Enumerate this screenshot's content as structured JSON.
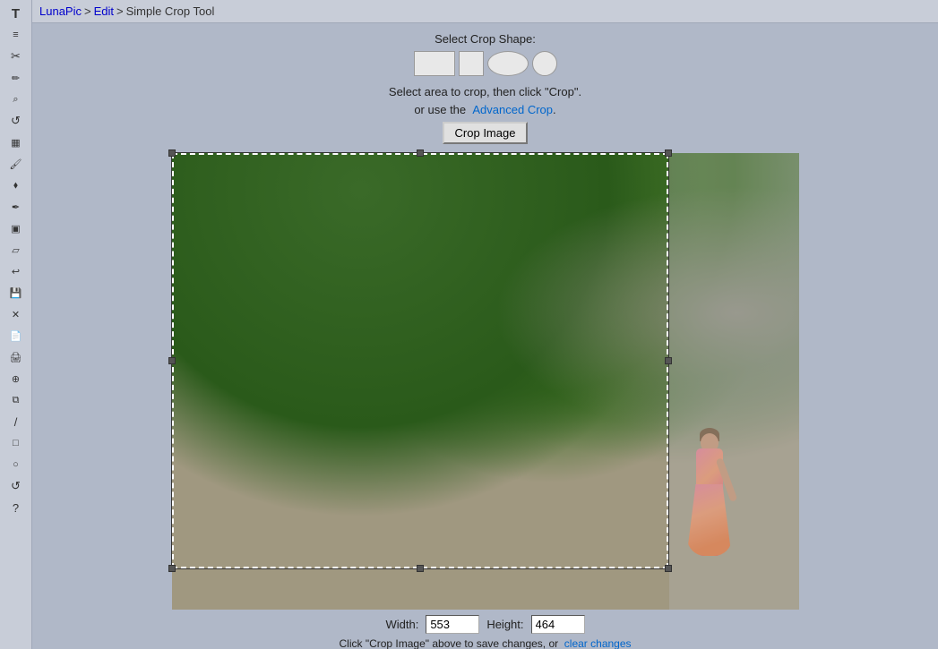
{
  "app": {
    "title": "LunaPic",
    "breadcrumb_sep": ">",
    "edit_label": "Edit",
    "page_label": "Simple Crop Tool"
  },
  "crop_shape": {
    "label": "Select Crop Shape:"
  },
  "instructions": {
    "line1": "Select area to crop, then click \"Crop\".",
    "line2_prefix": "or use the",
    "advanced_link": "Advanced Crop",
    "advanced_link_suffix": "."
  },
  "crop_button": {
    "label": "Crop Image"
  },
  "dimensions": {
    "width_label": "Width:",
    "width_value": "553",
    "height_label": "Height:",
    "height_value": "464"
  },
  "dim_note": {
    "prefix": "Click \"Crop Image\" above to save changes, or",
    "clear_link": "clear changes"
  },
  "shapes": [
    {
      "id": "rect",
      "label": "Rectangle"
    },
    {
      "id": "square",
      "label": "Square"
    },
    {
      "id": "ellipse",
      "label": "Ellipse"
    },
    {
      "id": "circle",
      "label": "Circle"
    }
  ],
  "tools": [
    {
      "id": "text",
      "icon": "T"
    },
    {
      "id": "lines",
      "icon": "≡"
    },
    {
      "id": "scissors",
      "icon": "✂"
    },
    {
      "id": "pen",
      "icon": "✏"
    },
    {
      "id": "magnify",
      "icon": "🔍"
    },
    {
      "id": "rotate",
      "icon": "↺"
    },
    {
      "id": "grid",
      "icon": "▦"
    },
    {
      "id": "paint",
      "icon": "🖌"
    },
    {
      "id": "dropper",
      "icon": "💉"
    },
    {
      "id": "pencil2",
      "icon": "✒"
    },
    {
      "id": "frames",
      "icon": "▣"
    },
    {
      "id": "eraser",
      "icon": "▱"
    },
    {
      "id": "undo",
      "icon": "↩"
    },
    {
      "id": "save",
      "icon": "💾"
    },
    {
      "id": "close",
      "icon": "✕"
    },
    {
      "id": "doc",
      "icon": "📄"
    },
    {
      "id": "print",
      "icon": "🖨"
    },
    {
      "id": "stamp",
      "icon": "⊕"
    },
    {
      "id": "copy",
      "icon": "⧉"
    },
    {
      "id": "line",
      "icon": "/"
    },
    {
      "id": "rect-tool",
      "icon": "□"
    },
    {
      "id": "ellipse-tool",
      "icon": "○"
    },
    {
      "id": "undo2",
      "icon": "↺"
    },
    {
      "id": "help",
      "icon": "?"
    }
  ]
}
